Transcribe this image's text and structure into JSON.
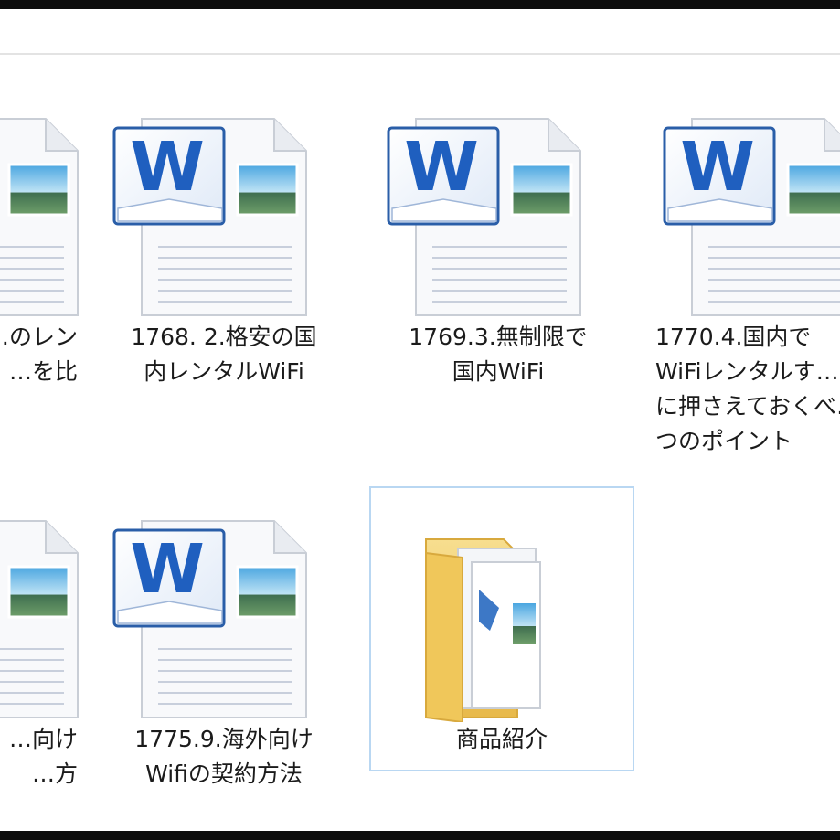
{
  "explorer": {
    "items": [
      {
        "name": "…のレン\n…を比",
        "type": "word-document",
        "icon": "word-document-icon"
      },
      {
        "name": "1768. 2.格安の国\n内レンタルWiFi",
        "type": "word-document",
        "icon": "word-document-icon"
      },
      {
        "name": "1769.3.無制限で\n国内WiFi",
        "type": "word-document",
        "icon": "word-document-icon"
      },
      {
        "name": "1770.4.国内で\nWiFiレンタルす…\nに押さえておくべ…\nつのポイント",
        "type": "word-document",
        "icon": "word-document-icon"
      },
      {
        "name": "…向け\n…方",
        "type": "word-document",
        "icon": "word-document-icon"
      },
      {
        "name": "1775.9.海外向け\nWifiの契約方法",
        "type": "word-document",
        "icon": "word-document-icon"
      },
      {
        "name": "商品紹介",
        "type": "folder",
        "icon": "folder-icon",
        "selected": true
      }
    ]
  },
  "colors": {
    "background": "#ffffff",
    "frame": "#0d0d0d",
    "selection_border": "#b9d7f2",
    "word_blue": "#1f5fbf",
    "folder_yellow": "#f3d27a"
  }
}
